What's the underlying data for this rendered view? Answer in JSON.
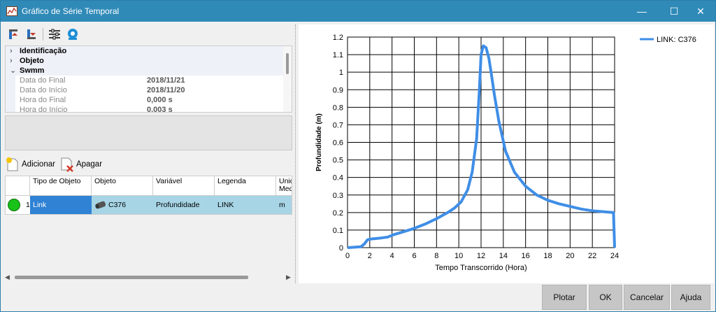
{
  "window": {
    "title": "Gráfico de Série Temporal",
    "controls": [
      "—",
      "☐",
      "✕"
    ]
  },
  "property_grid": {
    "categories": [
      {
        "label": "Identificação",
        "expanded": false
      },
      {
        "label": "Objeto",
        "expanded": false
      },
      {
        "label": "Swmm",
        "expanded": true
      }
    ],
    "properties": [
      {
        "name": "Data do Final",
        "value": "2018/11/21"
      },
      {
        "name": "Data do Início",
        "value": "2018/11/20"
      },
      {
        "name": "Hora do Final",
        "value": "0,000 s"
      },
      {
        "name": "Hora do Início",
        "value": "0,003 s"
      }
    ]
  },
  "actions": {
    "add_label": "Adicionar",
    "delete_label": "Apagar"
  },
  "series_grid": {
    "headers": [
      "",
      "Tipo de Objeto",
      "Objeto",
      "Variável",
      "Legenda",
      "Unid Med"
    ],
    "rows": [
      {
        "index": "1",
        "tipo": "Link",
        "objeto": "C376",
        "variavel": "Profundidade",
        "legenda": "LINK",
        "unidade": "m",
        "status_color": "#18c218"
      }
    ]
  },
  "buttons": {
    "plot": "Plotar",
    "ok": "OK",
    "cancel": "Cancelar",
    "help": "Ajuda"
  },
  "social_icons": [
    "refresh-icon",
    "facebook-icon",
    "twitter-icon",
    "linkedin-icon"
  ],
  "colors": {
    "titlebar": "#2f8ab8",
    "series": "#3f8ee6",
    "row_selected": "#a7d5e6"
  },
  "chart_data": {
    "type": "line",
    "title": "",
    "xlabel": "Tempo Transcorrido (Hora)",
    "ylabel": "Profundidade (m)",
    "xlim": [
      0,
      24
    ],
    "ylim": [
      0,
      1.2
    ],
    "xticks": [
      0,
      2,
      4,
      6,
      8,
      10,
      12,
      14,
      16,
      18,
      20,
      22,
      24
    ],
    "yticks": [
      0,
      0.1,
      0.2,
      0.3,
      0.4,
      0.5,
      0.6,
      0.7,
      0.8,
      0.9,
      1,
      1.1,
      1.2
    ],
    "ytick_labels": [
      "0",
      "0.1",
      "0.2",
      "0.3",
      "0.4",
      "0.5",
      "0.6",
      "0.7",
      "0.8",
      "0.9",
      "1",
      "1.1",
      "1.2"
    ],
    "grid": true,
    "legend_position": "top-right",
    "series": [
      {
        "name": "LINK: C376",
        "x": [
          0,
          1.2,
          1.5,
          1.8,
          2.2,
          3.0,
          3.6,
          4.2,
          5.0,
          6.0,
          7.0,
          8.0,
          9.0,
          9.6,
          10.2,
          10.8,
          11.2,
          11.6,
          11.85,
          12.0,
          12.2,
          12.45,
          12.7,
          12.9,
          13.2,
          13.6,
          14.2,
          15.0,
          16.0,
          17.0,
          18.0,
          19.0,
          20.0,
          21.0,
          22.0,
          23.0,
          23.9,
          24.0
        ],
        "y": [
          0,
          0.005,
          0.02,
          0.045,
          0.05,
          0.055,
          0.06,
          0.075,
          0.09,
          0.11,
          0.135,
          0.165,
          0.2,
          0.225,
          0.26,
          0.33,
          0.43,
          0.62,
          0.9,
          1.1,
          1.15,
          1.14,
          1.08,
          1.0,
          0.87,
          0.72,
          0.55,
          0.43,
          0.35,
          0.3,
          0.27,
          0.25,
          0.235,
          0.22,
          0.21,
          0.205,
          0.2,
          0.0
        ]
      }
    ]
  }
}
